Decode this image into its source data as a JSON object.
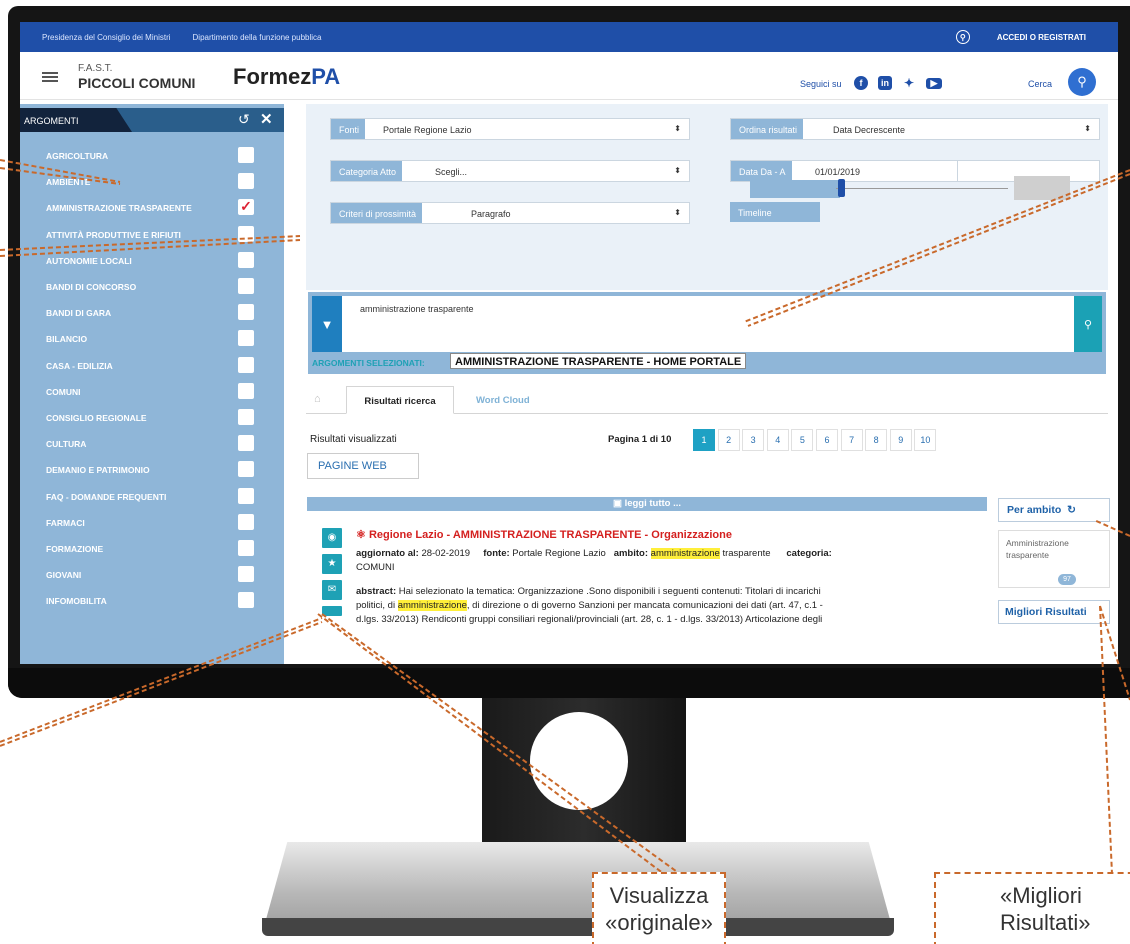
{
  "topbar": {
    "links": [
      "Presidenza del Consiglio dei Ministri",
      "Dipartimento della funzione pubblica"
    ],
    "login": "ACCEDI O REGISTRATI"
  },
  "header": {
    "brand_line1": "F.A.S.T.",
    "brand_line2": "PICCOLI COMUNI",
    "formez_a": "Formez",
    "formez_b": "PA",
    "follow": "Seguici su",
    "search": "Cerca"
  },
  "sidebar": {
    "title": "ARGOMENTI",
    "items": [
      {
        "label": "AGRICOLTURA",
        "checked": false
      },
      {
        "label": "AMBIENTE",
        "checked": false
      },
      {
        "label": "AMMINISTRAZIONE TRASPARENTE",
        "checked": true
      },
      {
        "label": "ATTIVITÀ PRODUTTIVE E RIFIUTI",
        "checked": false
      },
      {
        "label": "AUTONOMIE LOCALI",
        "checked": false
      },
      {
        "label": "BANDI DI CONCORSO",
        "checked": false
      },
      {
        "label": "BANDI DI GARA",
        "checked": false
      },
      {
        "label": "BILANCIO",
        "checked": false
      },
      {
        "label": "CASA - EDILIZIA",
        "checked": false
      },
      {
        "label": "COMUNI",
        "checked": false
      },
      {
        "label": "CONSIGLIO REGIONALE",
        "checked": false
      },
      {
        "label": "CULTURA",
        "checked": false
      },
      {
        "label": "DEMANIO E PATRIMONIO",
        "checked": false
      },
      {
        "label": "FAQ - DOMANDE FREQUENTI",
        "checked": false
      },
      {
        "label": "FARMACI",
        "checked": false
      },
      {
        "label": "FORMAZIONE",
        "checked": false
      },
      {
        "label": "GIOVANI",
        "checked": false
      },
      {
        "label": "INFOMOBILITA",
        "checked": false
      }
    ]
  },
  "filters": {
    "fonti_label": "Fonti",
    "fonti_value": "Portale Regione Lazio",
    "ordina_label": "Ordina risultati",
    "ordina_value": "Data Decrescente",
    "categoria_label": "Categoria Atto",
    "categoria_value": "Scegli...",
    "data_label": "Data Da - A",
    "data_value": "01/01/2019",
    "prossimita_label": "Criteri di prossimità",
    "prossimita_value": "Paragrafo",
    "timeline_label": "Timeline"
  },
  "search": {
    "query": "amministrazione trasparente",
    "selected_label": "ARGOMENTI SELEZIONATI:",
    "selected_value": "AMMINISTRAZIONE TRASPARENTE - HOME PORTALE"
  },
  "tabs": {
    "results": "Risultati ricerca",
    "cloud": "Word Cloud"
  },
  "results": {
    "shown_label": "Risultati visualizzati",
    "page_text": "Pagina 1 di 10",
    "pages": [
      "1",
      "2",
      "3",
      "4",
      "5",
      "6",
      "7",
      "8",
      "9",
      "10"
    ],
    "type_button": "PAGINE WEB",
    "read_all": "leggi tutto ..."
  },
  "document": {
    "title": "Regione Lazio - AMMINISTRAZIONE TRASPARENTE - Organizzazione",
    "updated_label": "aggiornato al:",
    "updated_value": "28-02-2019",
    "source_label": "fonte:",
    "source_value": "Portale Regione Lazio",
    "ambito_label": "ambito:",
    "ambito_hl": "amministrazione",
    "ambito_rest": "trasparente",
    "categoria_label": "categoria:",
    "categoria_value": "COMUNI",
    "abstract_label": "abstract:",
    "abstract_1": "Hai selezionato la tematica: Organizzazione .Sono disponibili i seguenti contenuti: Titolari di incarichi",
    "abstract_2a": "politici, di",
    "abstract_2hl": "amministrazione",
    "abstract_2b": ", di direzione o di governo Sanzioni per mancata comunicazioni dei dati (art. 47, c.1 -",
    "abstract_3": "d.lgs. 33/2013) Rendiconti gruppi consiliari regionali/provinciali (art. 28, c. 1 - d.lgs. 33/2013) Articolazione degli"
  },
  "ambito": {
    "title": "Per ambito",
    "item_line1": "Amministrazione",
    "item_line2": "trasparente",
    "count": "97",
    "best": "Migliori Risultati"
  },
  "callouts": {
    "visualizza_1": "Visualizza",
    "visualizza_2": "«originale»",
    "migliori_1": "«Migliori",
    "migliori_2": "Risultati»"
  },
  "colors": {
    "accent": "#1f4fa8",
    "sidebar": "#8fb6d8",
    "teal": "#1ea1b5",
    "callout": "#c9692b"
  }
}
